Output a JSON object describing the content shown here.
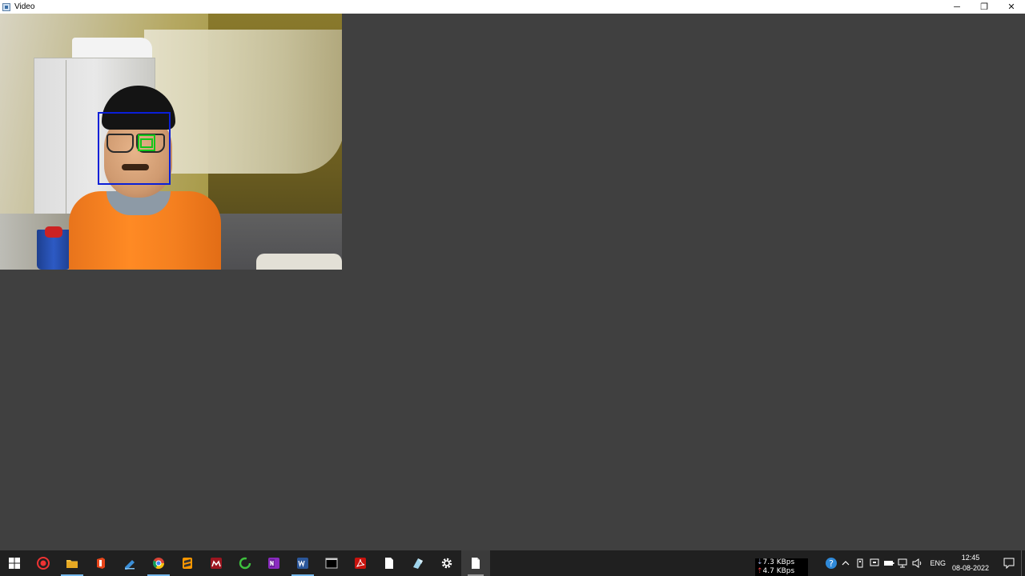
{
  "window": {
    "title": "Video",
    "controls": {
      "minimize": "─",
      "restore": "❐",
      "close": "✕"
    }
  },
  "taskbar": {
    "items": [
      {
        "name": "start",
        "icon": "windows-logo-icon"
      },
      {
        "name": "screen-recorder",
        "icon": "record-icon"
      },
      {
        "name": "file-explorer",
        "icon": "folder-icon"
      },
      {
        "name": "office",
        "icon": "office-icon"
      },
      {
        "name": "pen-app",
        "icon": "pen-icon"
      },
      {
        "name": "chrome",
        "icon": "chrome-icon"
      },
      {
        "name": "sublime-text",
        "icon": "sublime-icon"
      },
      {
        "name": "mendeley",
        "icon": "mendeley-icon"
      },
      {
        "name": "refresh-app",
        "icon": "circular-arrow-icon"
      },
      {
        "name": "onenote",
        "icon": "onenote-icon"
      },
      {
        "name": "word",
        "icon": "word-icon"
      },
      {
        "name": "terminal",
        "icon": "terminal-icon"
      },
      {
        "name": "acrobat",
        "icon": "acrobat-icon"
      },
      {
        "name": "notepad",
        "icon": "document-icon"
      },
      {
        "name": "paint-app",
        "icon": "paint-icon"
      },
      {
        "name": "settings",
        "icon": "gear-icon"
      },
      {
        "name": "video-window",
        "icon": "document-icon"
      }
    ],
    "net_speed": {
      "down": "7.3 KBps",
      "up": "4.7 KBps"
    },
    "language": "ENG",
    "time": "12:45",
    "date": "08-08-2022"
  }
}
